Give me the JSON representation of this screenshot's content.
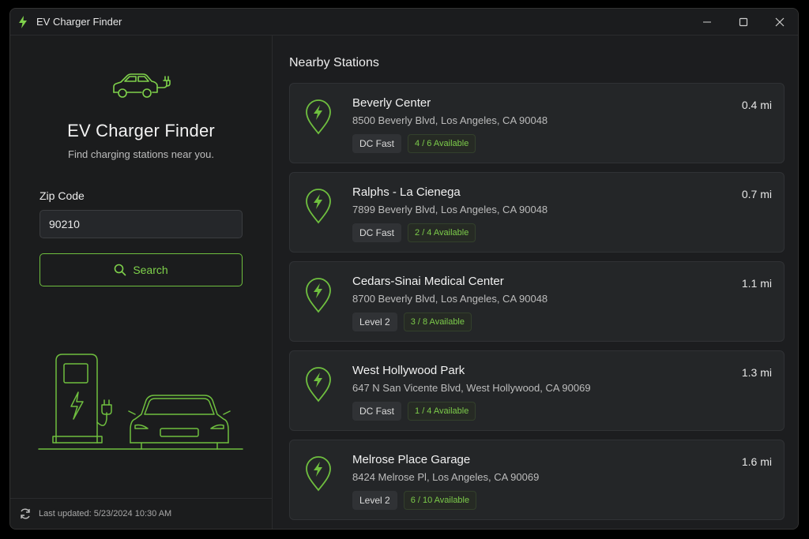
{
  "window": {
    "title": "EV Charger Finder",
    "controls": [
      "minimize-icon",
      "maximize-icon",
      "close-icon"
    ]
  },
  "colors": {
    "accent": "#7fd24b",
    "background": "#1c1d1f",
    "card": "#242628"
  },
  "sidebar": {
    "heading": "EV Charger Finder",
    "subtitle": "Find charging stations near you.",
    "zip_label": "Zip Code",
    "zip_value": "90210",
    "search_label": "Search",
    "search_icon": "search-icon",
    "footer_icon": "refresh-icon",
    "last_updated": "Last updated: 5/23/2024 10:30 AM"
  },
  "main": {
    "title": "Nearby Stations",
    "stations": [
      {
        "name": "Beverly Center",
        "address": "8500 Beverly Blvd, Los Angeles, CA 90048",
        "distance": "0.4 mi",
        "type": "DC Fast",
        "availability": "4 / 6 Available"
      },
      {
        "name": "Ralphs - La Cienega",
        "address": "7899 Beverly Blvd, Los Angeles, CA 90048",
        "distance": "0.7 mi",
        "type": "DC Fast",
        "availability": "2 / 4 Available"
      },
      {
        "name": "Cedars-Sinai Medical Center",
        "address": "8700 Beverly Blvd, Los Angeles, CA 90048",
        "distance": "1.1 mi",
        "type": "Level 2",
        "availability": "3 / 8 Available"
      },
      {
        "name": "West Hollywood Park",
        "address": "647 N San Vicente Blvd, West Hollywood, CA 90069",
        "distance": "1.3 mi",
        "type": "DC Fast",
        "availability": "1 / 4 Available"
      },
      {
        "name": "Melrose Place Garage",
        "address": "8424 Melrose Pl, Los Angeles, CA 90069",
        "distance": "1.6 mi",
        "type": "Level 2",
        "availability": "6 / 10 Available"
      }
    ]
  }
}
